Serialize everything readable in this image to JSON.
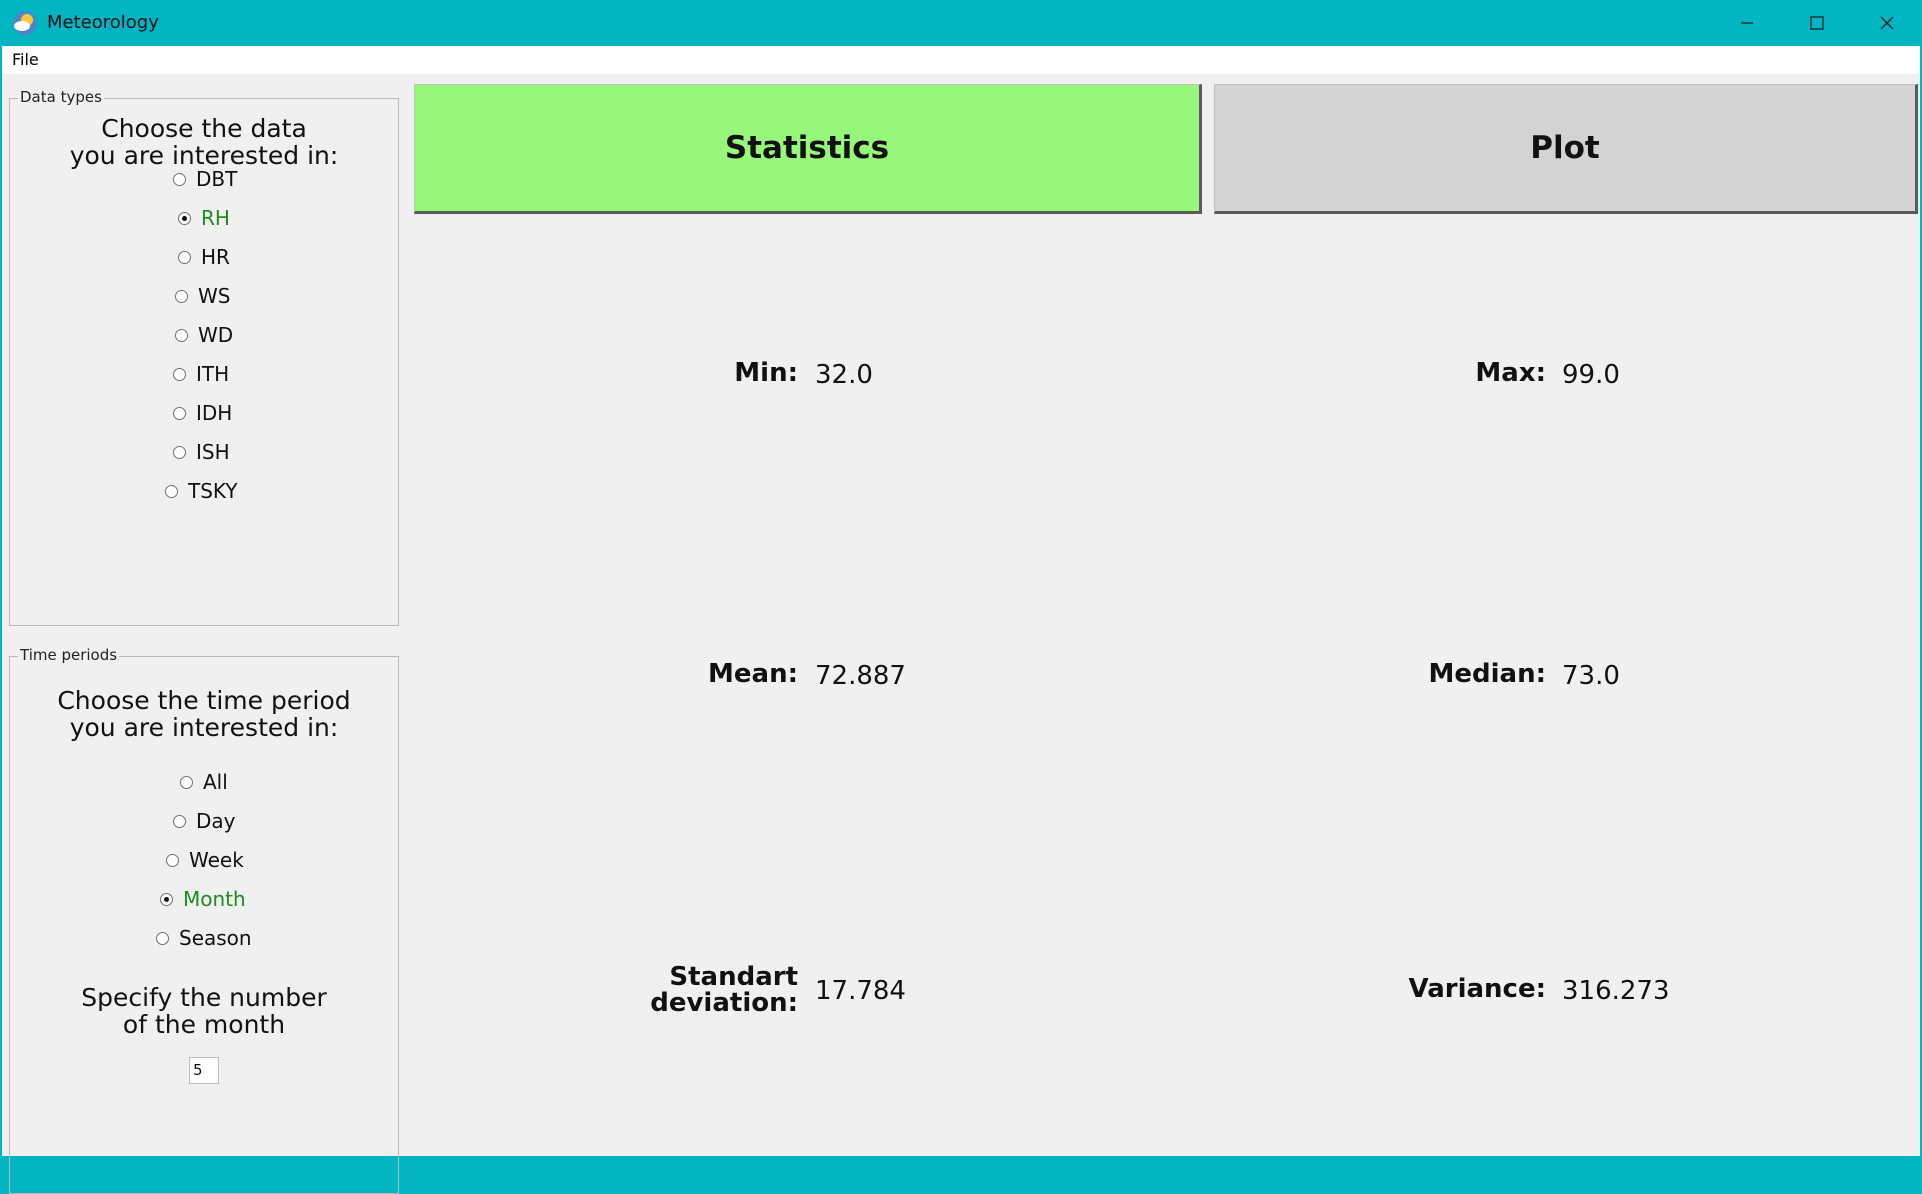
{
  "window": {
    "title": "Meteorology"
  },
  "menu": {
    "file": "File"
  },
  "data_types": {
    "legend": "Data types",
    "prompt_line1": "Choose the data",
    "prompt_line2": "you are interested in:",
    "options": [
      {
        "label": "DBT",
        "checked": false
      },
      {
        "label": "RH",
        "checked": true
      },
      {
        "label": "HR",
        "checked": false
      },
      {
        "label": "WS",
        "checked": false
      },
      {
        "label": "WD",
        "checked": false
      },
      {
        "label": "ITH",
        "checked": false
      },
      {
        "label": "IDH",
        "checked": false
      },
      {
        "label": "ISH",
        "checked": false
      },
      {
        "label": "TSKY",
        "checked": false
      }
    ]
  },
  "time_periods": {
    "legend": "Time periods",
    "prompt_line1": "Choose the time period",
    "prompt_line2": "you are interested in:",
    "options": [
      {
        "label": "All",
        "checked": false
      },
      {
        "label": "Day",
        "checked": false
      },
      {
        "label": "Week",
        "checked": false
      },
      {
        "label": "Month",
        "checked": true
      },
      {
        "label": "Season",
        "checked": false
      }
    ],
    "specify_line1": "Specify the number",
    "specify_line2": "of the month",
    "month_value": "5"
  },
  "tabs": {
    "statistics": "Statistics",
    "plot": "Plot",
    "active": "statistics"
  },
  "stats": {
    "min_label": "Min:",
    "min_value": "32.0",
    "max_label": "Max:",
    "max_value": "99.0",
    "mean_label": "Mean:",
    "mean_value": "72.887",
    "median_label": "Median:",
    "median_value": "73.0",
    "std_label_line1": "Standart",
    "std_label_line2": "deviation:",
    "std_value": "17.784",
    "variance_label": "Variance:",
    "variance_value": "316.273"
  },
  "colors": {
    "titlebar": "#01b5c3",
    "active_tab": "#97f77b",
    "inactive_tab": "#d3d3d3",
    "checked_text": "#1f8c1f"
  }
}
